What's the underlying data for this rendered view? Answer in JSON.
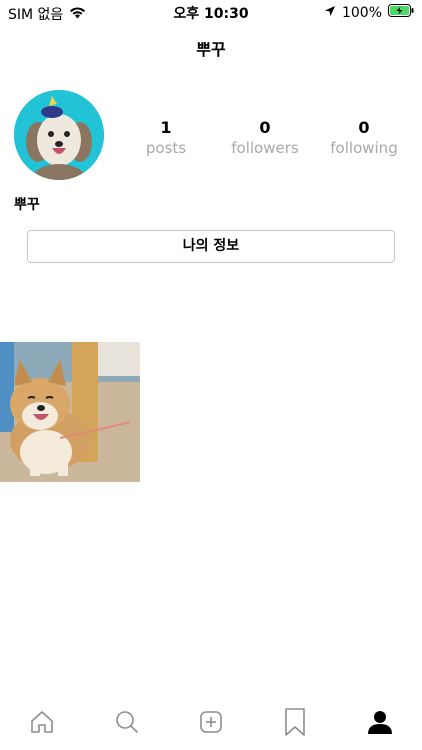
{
  "status_bar": {
    "carrier": "SIM 없음",
    "time": "오후 10:30",
    "battery": "100%"
  },
  "header": {
    "title": "뿌꾸"
  },
  "profile": {
    "username": "뿌꾸",
    "stats": [
      {
        "value": "1",
        "label": "posts"
      },
      {
        "value": "0",
        "label": "followers"
      },
      {
        "value": "0",
        "label": "following"
      }
    ],
    "edit_button_label": "나의 정보"
  },
  "tabbar": {
    "items": [
      "home-icon",
      "search-icon",
      "add-post-icon",
      "bookmark-icon",
      "profile-icon"
    ],
    "active": "profile-icon"
  },
  "colors": {
    "avatar_bg": "#22c3d6",
    "muted_text": "#a8a8a8",
    "battery_green": "#4cd964"
  }
}
